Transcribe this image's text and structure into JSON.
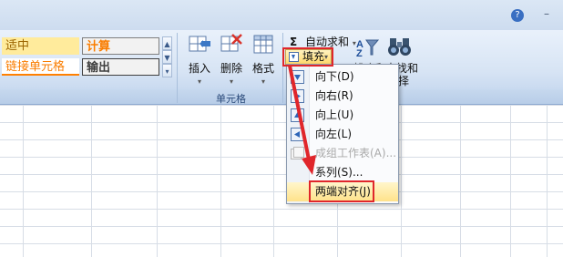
{
  "window": {
    "help_glyph": "?",
    "min_glyph": "–"
  },
  "styles": {
    "cells": [
      {
        "label": "适中",
        "bg": "#ffeb9c",
        "color": "#9c6500"
      },
      {
        "label": "计算",
        "bg": "#f2f2f2",
        "color": "#fa7d00"
      },
      {
        "label": "链接单元格",
        "bg": "#ffffff",
        "color": "#fa7d00"
      },
      {
        "label": "输出",
        "bg": "#f2f2f2",
        "color": "#3f3f3f"
      }
    ],
    "scroll": [
      "▲",
      "▼",
      "▾"
    ]
  },
  "cells_group": {
    "label": "单元格",
    "insert": "插入",
    "delete": "删除",
    "format": "格式",
    "arrow": "▾"
  },
  "editing": {
    "autosum": "自动求和",
    "autosum_symbol": "Σ",
    "autosum_arrow": "▾",
    "fill": "填充",
    "fill_arrow": "▾",
    "sort_partial": "排序和",
    "find_partial": "查找和",
    "find_partial2": "择"
  },
  "fill_menu": {
    "items": [
      {
        "label": "向下(D)",
        "icon": "fill-down-icon"
      },
      {
        "label": "向右(R)",
        "icon": "fill-right-icon"
      },
      {
        "label": "向上(U)",
        "icon": "fill-up-icon"
      },
      {
        "label": "向左(L)",
        "icon": "fill-left-icon"
      },
      {
        "label": "成组工作表(A)...",
        "icon": "fill-across-sheets-icon",
        "disabled": true
      },
      {
        "label": "系列(S)...",
        "icon": ""
      },
      {
        "label": "两端对齐(J)",
        "icon": "",
        "highlighted": true
      }
    ]
  },
  "colors": {
    "annotation_red": "#e0262b"
  }
}
